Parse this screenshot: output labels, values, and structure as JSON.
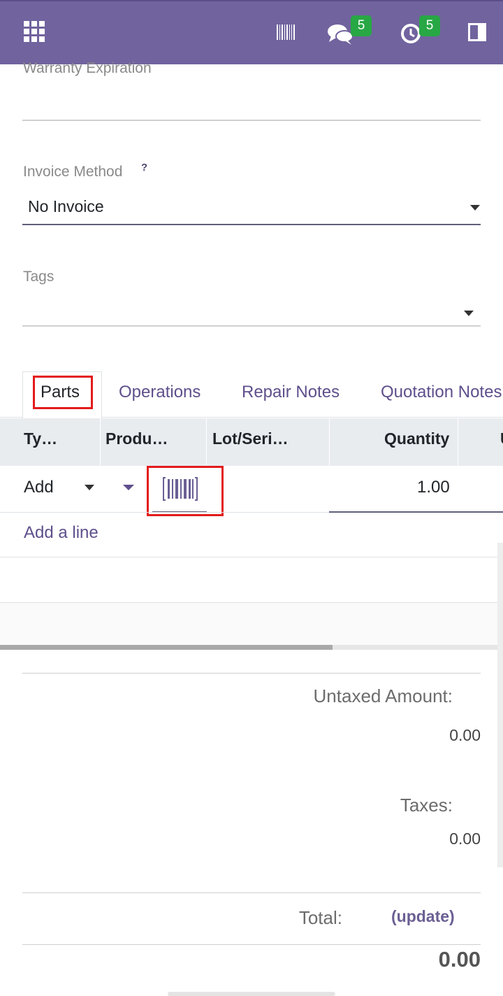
{
  "navbar": {
    "icons": [
      "apps-grid-icon",
      "barcode-icon",
      "chat-icon",
      "clock-icon",
      "side-panel-icon"
    ],
    "messages_badge": "5",
    "activities_badge": "5",
    "color": "#71639e",
    "badge_color": "#28a745"
  },
  "form": {
    "warranty_label": "Warranty Expiration",
    "warranty_value": "",
    "invoice_method_label": "Invoice Method",
    "invoice_method_help": "?",
    "invoice_method_value": "No Invoice",
    "tags_label": "Tags",
    "tags_value": ""
  },
  "tabs": [
    {
      "label": "Parts",
      "active": true
    },
    {
      "label": "Operations",
      "active": false
    },
    {
      "label": "Repair Notes",
      "active": false
    },
    {
      "label": "Quotation Notes",
      "active": false
    }
  ],
  "table": {
    "columns": [
      "Ty…",
      "Produ…",
      "Lot/Seri…",
      "Quantity",
      "U"
    ],
    "rows": [
      {
        "type": "Add",
        "product": "",
        "lot": "",
        "quantity": "1.00"
      }
    ],
    "add_line_label": "Add a line"
  },
  "totals": {
    "untaxed_label": "Untaxed Amount:",
    "untaxed_value": "0.00",
    "taxes_label": "Taxes:",
    "taxes_value": "0.00",
    "total_label": "Total:",
    "update_label": "(update)",
    "total_value": "0.00"
  },
  "highlight_color": "#e31b1b"
}
